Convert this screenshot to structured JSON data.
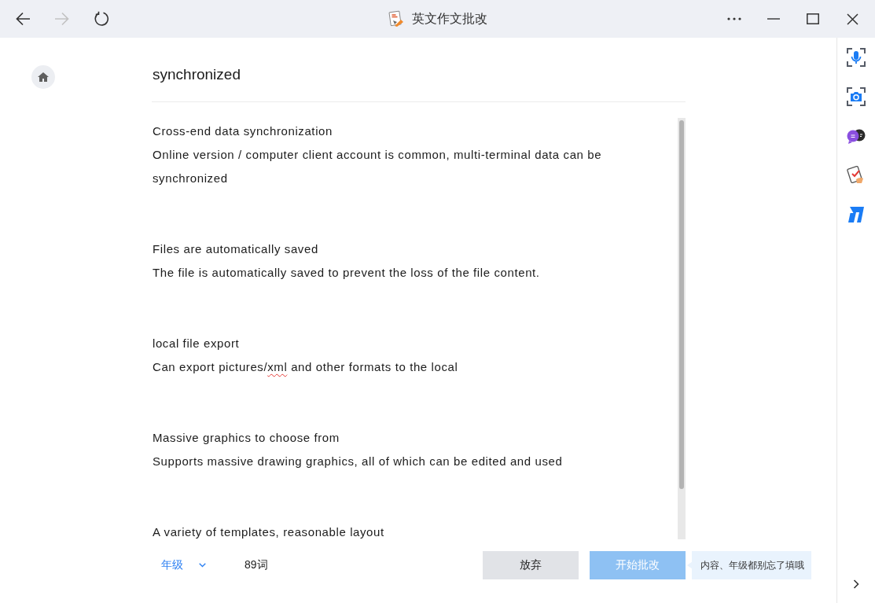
{
  "window": {
    "title": "英文作文批改"
  },
  "nav_buttons": [
    {
      "kind": "back",
      "disabled": false
    },
    {
      "kind": "forward",
      "disabled": true
    },
    {
      "kind": "refresh",
      "disabled": false
    }
  ],
  "document": {
    "title": "synchronized",
    "blocks": [
      {
        "heading": "Cross-end data synchronization",
        "body": [
          {
            "text": "Online version / computer client account is common, multi-terminal data can be synchronized",
            "misspelled": false
          }
        ]
      },
      {
        "heading": "Files are automatically saved",
        "body": [
          {
            "text": "The file is automatically saved to prevent the loss of the file content.",
            "misspelled": false
          }
        ]
      },
      {
        "heading": "local file export",
        "body": [
          {
            "text": "Can export pictures/",
            "misspelled": false
          },
          {
            "text": "xml",
            "misspelled": true
          },
          {
            "text": " and other formats to the local",
            "misspelled": false
          }
        ]
      },
      {
        "heading": "Massive graphics to choose from",
        "body": [
          {
            "text": "Supports massive drawing graphics, all of which can be edited and used",
            "misspelled": false
          }
        ]
      },
      {
        "heading": "A variety of templates, reasonable layout"
      }
    ]
  },
  "footer": {
    "grade_select": {
      "label": "年级"
    },
    "word_count": "89词",
    "buttons": [
      {
        "label": "放弃",
        "kind": "secondary",
        "disabled": false
      },
      {
        "label": "开始批改",
        "kind": "primary",
        "disabled": true
      }
    ],
    "hint": "内容、年级都别忘了填哦"
  }
}
